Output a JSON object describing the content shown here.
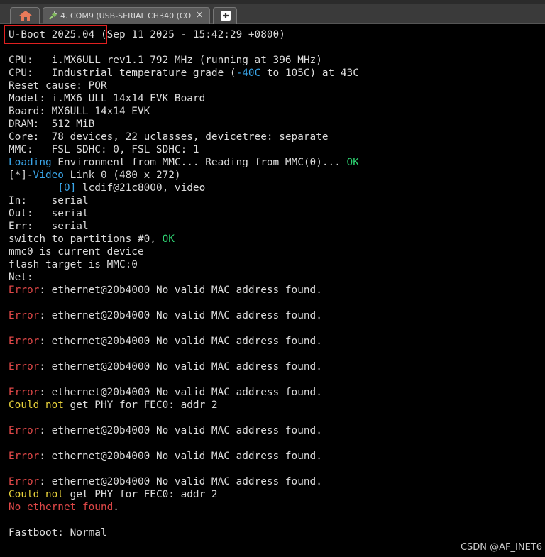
{
  "tabs": {
    "home_icon": "home-icon",
    "session": {
      "icon": "plug-icon",
      "label": "4. COM9  (USB-SERIAL CH340 (CO",
      "close": "×"
    },
    "new_tab_icon": "plus-icon"
  },
  "colors": {
    "cyan": "#3aa5e8",
    "green": "#2ed573",
    "red": "#e04848",
    "yellow": "#e8d23a",
    "text": "#dcdcdc",
    "highlight": "#e02020"
  },
  "terminal": {
    "lines": [
      [
        {
          "t": "U-Boot 2025.04 (Sep 11 2025 - 15:42:29 +0800)"
        }
      ],
      [
        {
          "t": ""
        }
      ],
      [
        {
          "t": "CPU:   i.MX6ULL rev1.1 792 MHz (running at 396 MHz)"
        }
      ],
      [
        {
          "t": "CPU:   Industrial temperature grade ("
        },
        {
          "t": "-40C",
          "c": "cyan"
        },
        {
          "t": " to 105C) at 43C"
        }
      ],
      [
        {
          "t": "Reset cause: POR"
        }
      ],
      [
        {
          "t": "Model: i.MX6 ULL 14x14 EVK Board"
        }
      ],
      [
        {
          "t": "Board: MX6ULL 14x14 EVK"
        }
      ],
      [
        {
          "t": "DRAM:  512 MiB"
        }
      ],
      [
        {
          "t": "Core:  78 devices, 22 uclasses, devicetree: separate"
        }
      ],
      [
        {
          "t": "MMC:   FSL_SDHC: 0, FSL_SDHC: 1"
        }
      ],
      [
        {
          "t": "Loading",
          "c": "cyan"
        },
        {
          "t": " Environment from MMC... Reading from MMC(0)... "
        },
        {
          "t": "OK",
          "c": "green"
        }
      ],
      [
        {
          "t": "[*]-"
        },
        {
          "t": "Video",
          "c": "cyan"
        },
        {
          "t": " Link 0 (480 x 272)"
        }
      ],
      [
        {
          "t": "        "
        },
        {
          "t": "[0]",
          "c": "cyan"
        },
        {
          "t": " lcdif@21c8000, video"
        }
      ],
      [
        {
          "t": "In:    serial"
        }
      ],
      [
        {
          "t": "Out:   serial"
        }
      ],
      [
        {
          "t": "Err:   serial"
        }
      ],
      [
        {
          "t": "switch to partitions #0, "
        },
        {
          "t": "OK",
          "c": "green"
        }
      ],
      [
        {
          "t": "mmc0 is current device"
        }
      ],
      [
        {
          "t": "flash target is MMC:0"
        }
      ],
      [
        {
          "t": "Net:"
        }
      ],
      [
        {
          "t": "Error",
          "c": "red"
        },
        {
          "t": ": ethernet@20b4000 No valid MAC address found."
        }
      ],
      [
        {
          "t": ""
        }
      ],
      [
        {
          "t": "Error",
          "c": "red"
        },
        {
          "t": ": ethernet@20b4000 No valid MAC address found."
        }
      ],
      [
        {
          "t": ""
        }
      ],
      [
        {
          "t": "Error",
          "c": "red"
        },
        {
          "t": ": ethernet@20b4000 No valid MAC address found."
        }
      ],
      [
        {
          "t": ""
        }
      ],
      [
        {
          "t": "Error",
          "c": "red"
        },
        {
          "t": ": ethernet@20b4000 No valid MAC address found."
        }
      ],
      [
        {
          "t": ""
        }
      ],
      [
        {
          "t": "Error",
          "c": "red"
        },
        {
          "t": ": ethernet@20b4000 No valid MAC address found."
        }
      ],
      [
        {
          "t": "Could not",
          "c": "yellow"
        },
        {
          "t": " get PHY for FEC0: addr 2"
        }
      ],
      [
        {
          "t": ""
        }
      ],
      [
        {
          "t": "Error",
          "c": "red"
        },
        {
          "t": ": ethernet@20b4000 No valid MAC address found."
        }
      ],
      [
        {
          "t": ""
        }
      ],
      [
        {
          "t": "Error",
          "c": "red"
        },
        {
          "t": ": ethernet@20b4000 No valid MAC address found."
        }
      ],
      [
        {
          "t": ""
        }
      ],
      [
        {
          "t": "Error",
          "c": "red"
        },
        {
          "t": ": ethernet@20b4000 No valid MAC address found."
        }
      ],
      [
        {
          "t": "Could not",
          "c": "yellow"
        },
        {
          "t": " get PHY for FEC0: addr 2"
        }
      ],
      [
        {
          "t": "No ethernet found",
          "c": "red"
        },
        {
          "t": "."
        }
      ],
      [
        {
          "t": ""
        }
      ],
      [
        {
          "t": "Fastboot: Normal"
        }
      ]
    ]
  },
  "watermark": "CSDN @AF_INET6"
}
